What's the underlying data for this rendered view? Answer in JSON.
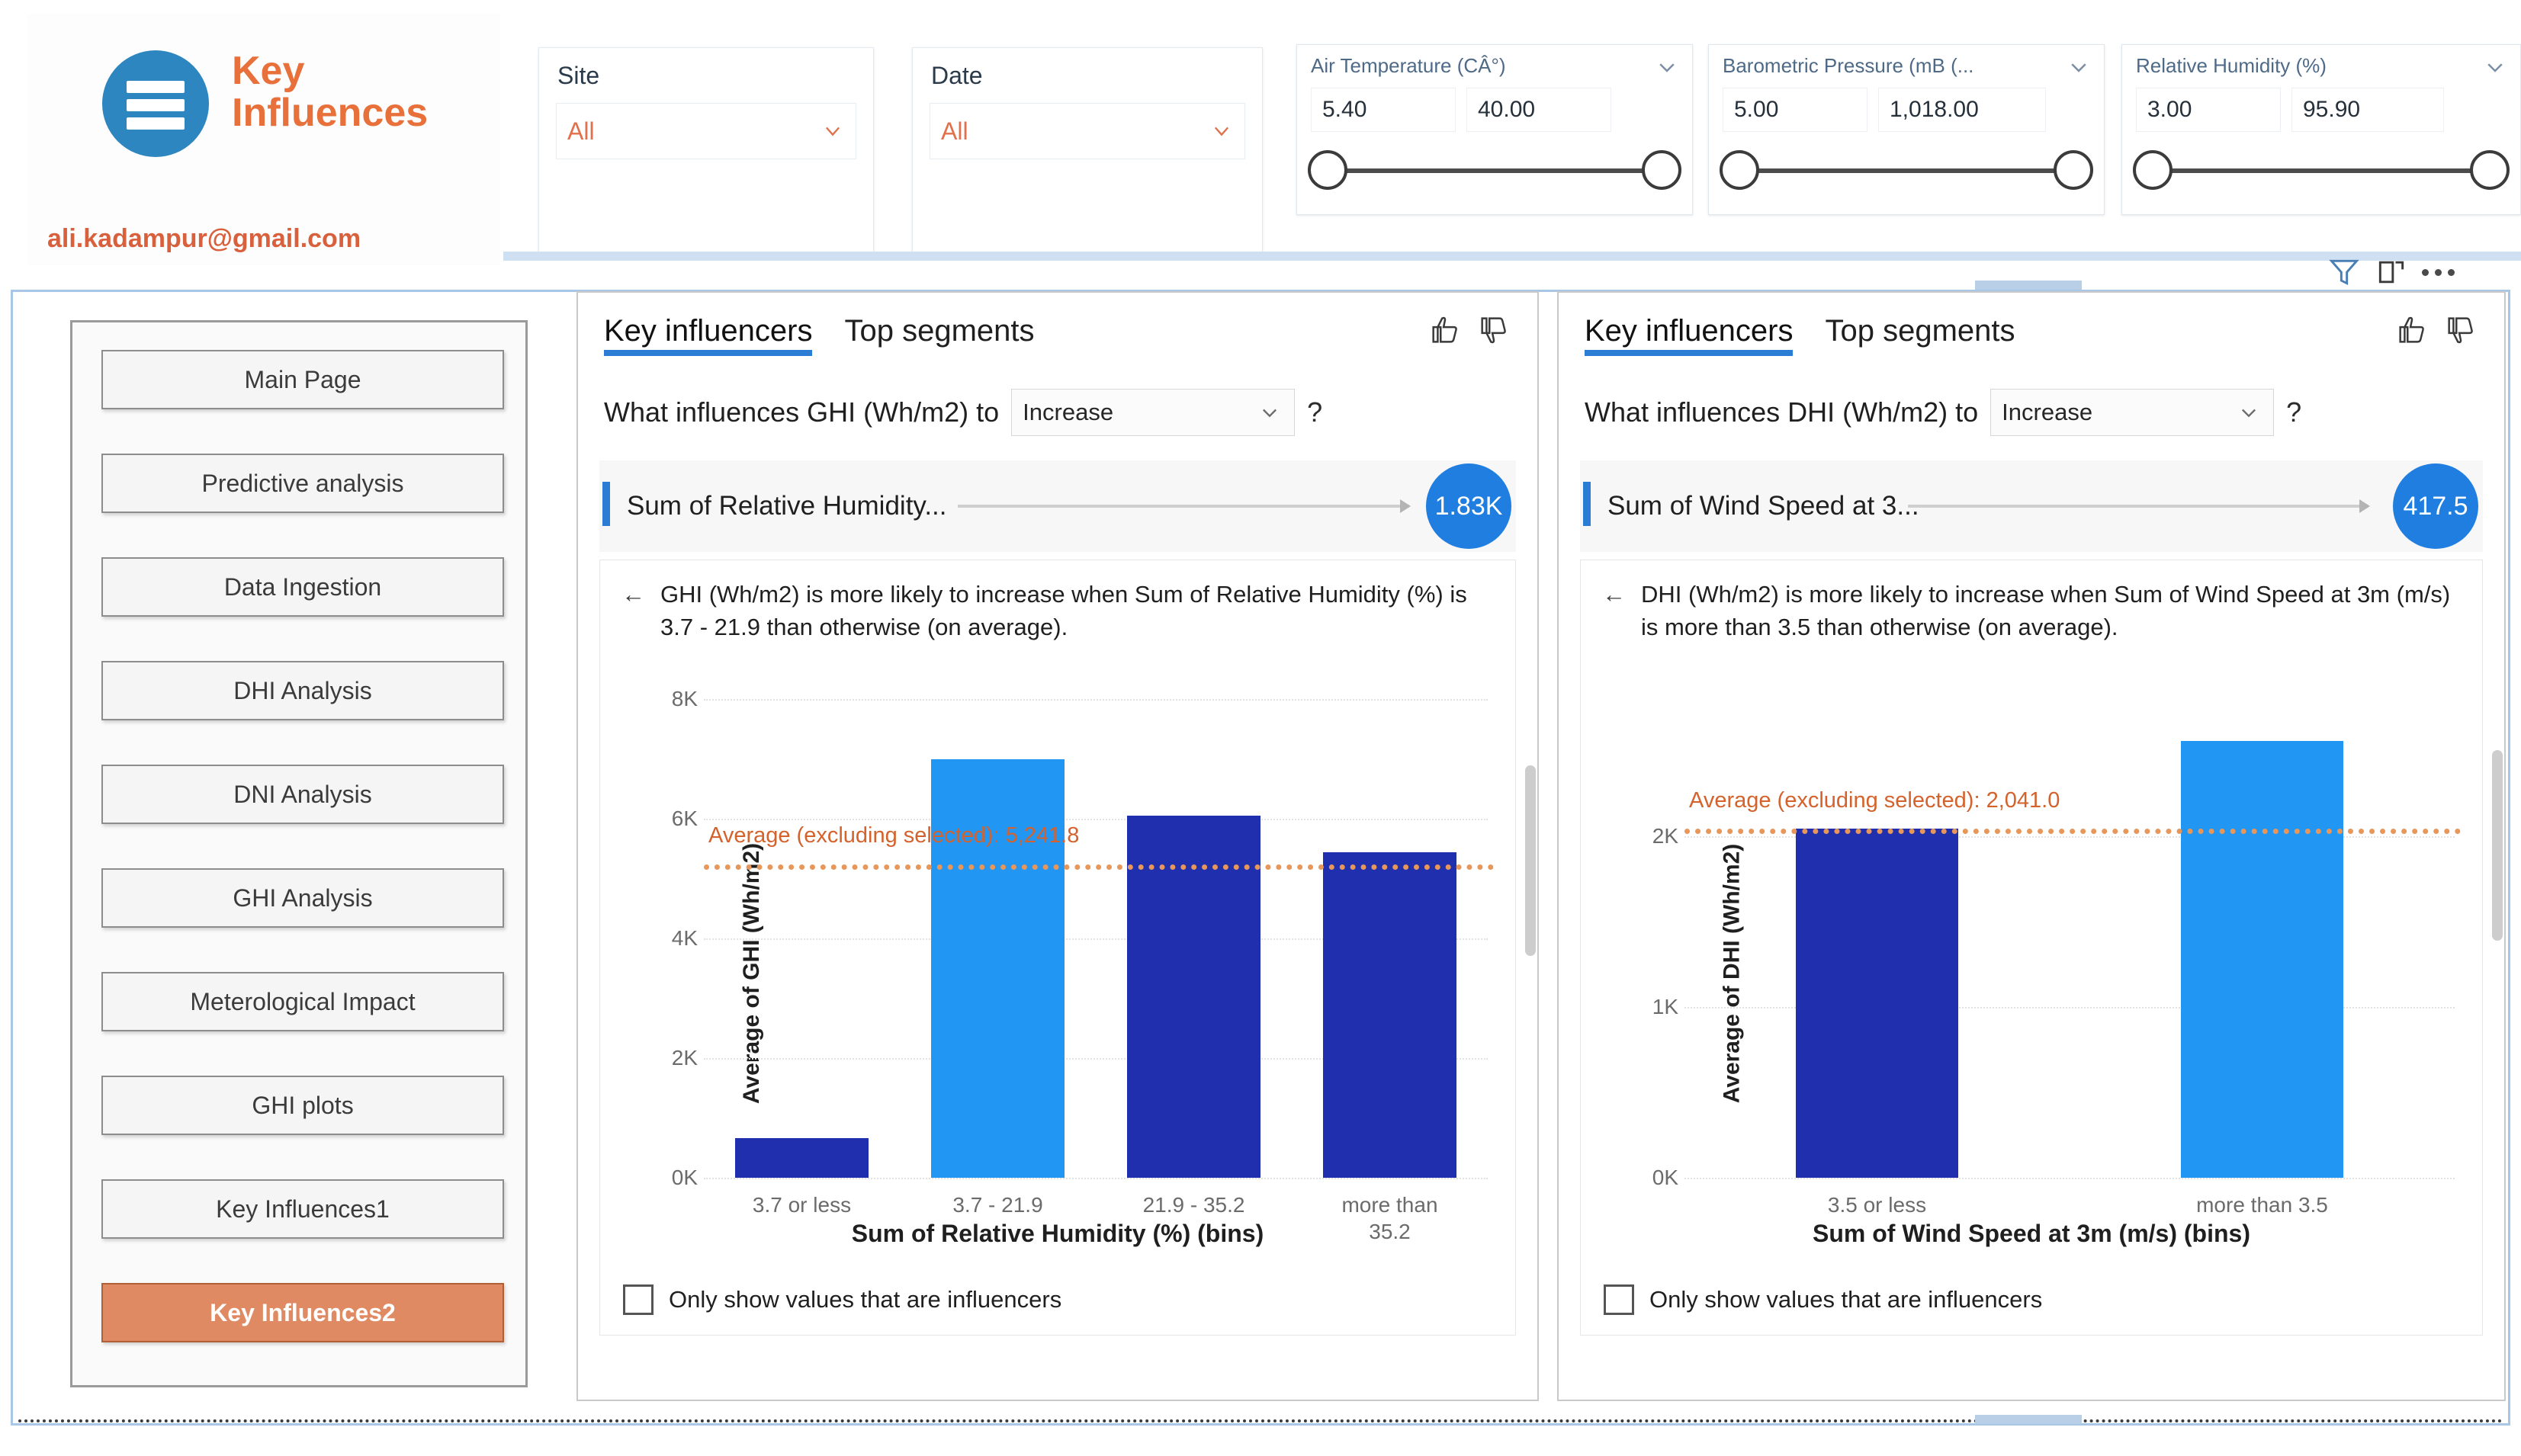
{
  "brand": {
    "title_line1": "Key",
    "title_line2": "Influences",
    "email": "ali.kadampur@gmail.com",
    "logo_icon": "hamburger-menu-icon",
    "logo_color": "#2e86c1",
    "title_color": "#e8703a"
  },
  "slicers": {
    "site": {
      "title": "Site",
      "value": "All",
      "caret_icon": "chevron-down-icon"
    },
    "date": {
      "title": "Date",
      "value": "All",
      "caret_icon": "chevron-down-icon"
    }
  },
  "range_slicers": [
    {
      "title": "Air Temperature (CÂ°)",
      "min_value": "5.40",
      "max_value": "40.00",
      "chevron_icon": "chevron-down-icon"
    },
    {
      "title": "Barometric Pressure (mB (...",
      "min_value": "5.00",
      "max_value": "1,018.00",
      "chevron_icon": "chevron-down-icon"
    },
    {
      "title": "Relative Humidity (%)",
      "min_value": "3.00",
      "max_value": "95.90",
      "chevron_icon": "chevron-down-icon"
    }
  ],
  "visual_toolbar": {
    "filter_icon": "filter-funnel-icon",
    "focus_icon": "focus-mode-icon",
    "more_icon": "more-options-icon"
  },
  "sidebar": {
    "items": [
      {
        "label": "Main Page",
        "active": false
      },
      {
        "label": "Predictive analysis",
        "active": false
      },
      {
        "label": "Data Ingestion",
        "active": false
      },
      {
        "label": "DHI Analysis",
        "active": false
      },
      {
        "label": "DNI Analysis",
        "active": false
      },
      {
        "label": "GHI Analysis",
        "active": false
      },
      {
        "label": "Meterological Impact",
        "active": false
      },
      {
        "label": "GHI plots",
        "active": false
      },
      {
        "label": "Key Influences1",
        "active": false
      },
      {
        "label": "Key Influences2",
        "active": true
      }
    ],
    "active_bg": "#e08a63",
    "active_text": "#ffffff"
  },
  "panels": [
    {
      "tabs": [
        {
          "label": "Key influencers",
          "active": true
        },
        {
          "label": "Top segments",
          "active": false
        }
      ],
      "thumbs_up_icon": "thumbs-up-icon",
      "thumbs_down_icon": "thumbs-down-icon",
      "question_prefix": "What influences GHI (Wh/m2) to",
      "question_select_value": "Increase",
      "question_help": "?",
      "summary_label": "Sum of Relative Humidity...",
      "summary_bubble_value": "1.83K",
      "back_arrow": "←",
      "explanation": "GHI (Wh/m2) is more likely to increase when Sum of Relative Humidity (%) is 3.7 - 21.9 than otherwise (on average)."
    },
    {
      "tabs": [
        {
          "label": "Key influencers",
          "active": true
        },
        {
          "label": "Top segments",
          "active": false
        }
      ],
      "thumbs_up_icon": "thumbs-up-icon",
      "thumbs_down_icon": "thumbs-down-icon",
      "question_prefix": "What influences DHI (Wh/m2) to",
      "question_select_value": "Increase",
      "question_help": "?",
      "summary_label": "Sum of Wind Speed at 3...",
      "summary_bubble_value": "417.5",
      "back_arrow": "←",
      "explanation": "DHI (Wh/m2) is more likely to increase when Sum of Wind Speed at 3m (m/s) is more than 3.5 than otherwise (on average)."
    }
  ],
  "checkbox_label": "Only show values that are influencers",
  "chart_data": [
    {
      "type": "bar",
      "title": "",
      "xlabel": "Sum of Relative Humidity (%) (bins)",
      "ylabel": "Average of GHI (Wh/m2)",
      "categories": [
        "3.7 or less",
        "3.7 - 21.9",
        "21.9 - 35.2",
        "more than 35.2"
      ],
      "values": [
        660,
        7000,
        6050,
        5440
      ],
      "highlighted_index": 1,
      "ylim": [
        0,
        8000
      ],
      "yticks": [
        "0K",
        "2K",
        "4K",
        "6K",
        "8K"
      ],
      "ytick_values": [
        0,
        2000,
        4000,
        6000,
        8000
      ],
      "grid": true,
      "legend": "none",
      "reference_line": {
        "label": "Average (excluding selected): 5,241.8",
        "value": 5241.8,
        "color": "#e8975a"
      },
      "bar_colors": {
        "default": "#1f2fae",
        "highlight": "#2196f3"
      }
    },
    {
      "type": "bar",
      "title": "",
      "xlabel": "Sum of Wind Speed at 3m (m/s) (bins)",
      "ylabel": "Average of DHI (Wh/m2)",
      "categories": [
        "3.5 or less",
        "more than 3.5"
      ],
      "values": [
        2041,
        2555
      ],
      "highlighted_index": 1,
      "ylim": [
        0,
        2800
      ],
      "yticks": [
        "0K",
        "1K",
        "2K"
      ],
      "ytick_values": [
        0,
        1000,
        2000
      ],
      "grid": true,
      "legend": "none",
      "reference_line": {
        "label": "Average (excluding selected): 2,041.0",
        "value": 2041,
        "color": "#e8975a"
      },
      "bar_colors": {
        "default": "#1f2fae",
        "highlight": "#2196f3"
      }
    }
  ]
}
